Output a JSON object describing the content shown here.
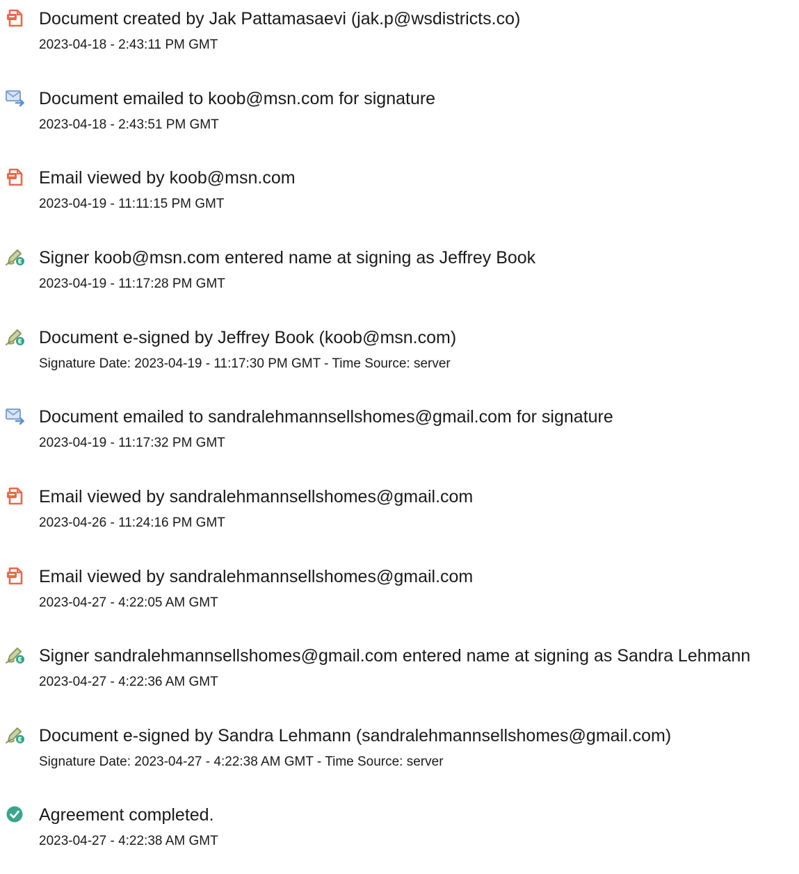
{
  "events": [
    {
      "icon": "document-created-icon",
      "title": "Document created by Jak Pattamasaevi (jak.p@wsdistricts.co)",
      "time": "2023-04-18 - 2:43:11 PM GMT"
    },
    {
      "icon": "email-sent-icon",
      "title": "Document emailed to koob@msn.com for signature",
      "time": "2023-04-18 - 2:43:51 PM GMT"
    },
    {
      "icon": "document-viewed-icon",
      "title": "Email viewed by koob@msn.com",
      "time": "2023-04-19 - 11:11:15 PM GMT"
    },
    {
      "icon": "e-sign-pen-icon",
      "title": "Signer koob@msn.com entered name at signing as Jeffrey Book",
      "time": "2023-04-19 - 11:17:28 PM GMT"
    },
    {
      "icon": "e-sign-pen-icon",
      "title": "Document e-signed by Jeffrey Book (koob@msn.com)",
      "time": "Signature Date: 2023-04-19 - 11:17:30 PM GMT - Time Source: server"
    },
    {
      "icon": "email-sent-icon",
      "title": "Document emailed to sandralehmannsellshomes@gmail.com for signature",
      "time": "2023-04-19 - 11:17:32 PM GMT"
    },
    {
      "icon": "document-viewed-icon",
      "title": "Email viewed by sandralehmannsellshomes@gmail.com",
      "time": "2023-04-26 - 11:24:16 PM GMT"
    },
    {
      "icon": "document-viewed-icon",
      "title": "Email viewed by sandralehmannsellshomes@gmail.com",
      "time": "2023-04-27 - 4:22:05 AM GMT"
    },
    {
      "icon": "e-sign-pen-icon",
      "title": "Signer sandralehmannsellshomes@gmail.com entered name at signing as Sandra Lehmann",
      "time": "2023-04-27 - 4:22:36 AM GMT"
    },
    {
      "icon": "e-sign-pen-icon",
      "title": "Document e-signed by Sandra Lehmann (sandralehmannsellshomes@gmail.com)",
      "time": "Signature Date: 2023-04-27 - 4:22:38 AM GMT - Time Source: server"
    },
    {
      "icon": "check-circle-icon",
      "title": "Agreement completed.",
      "time": "2023-04-27 - 4:22:38 AM GMT"
    }
  ],
  "colors": {
    "document_icon": "#e8694a",
    "email_icon": "#7ea3d6",
    "pen_icon": "#8a9a5b",
    "pen_badge": "#2fa38a",
    "check_icon": "#39a68c",
    "text": "#1a1a1a"
  }
}
